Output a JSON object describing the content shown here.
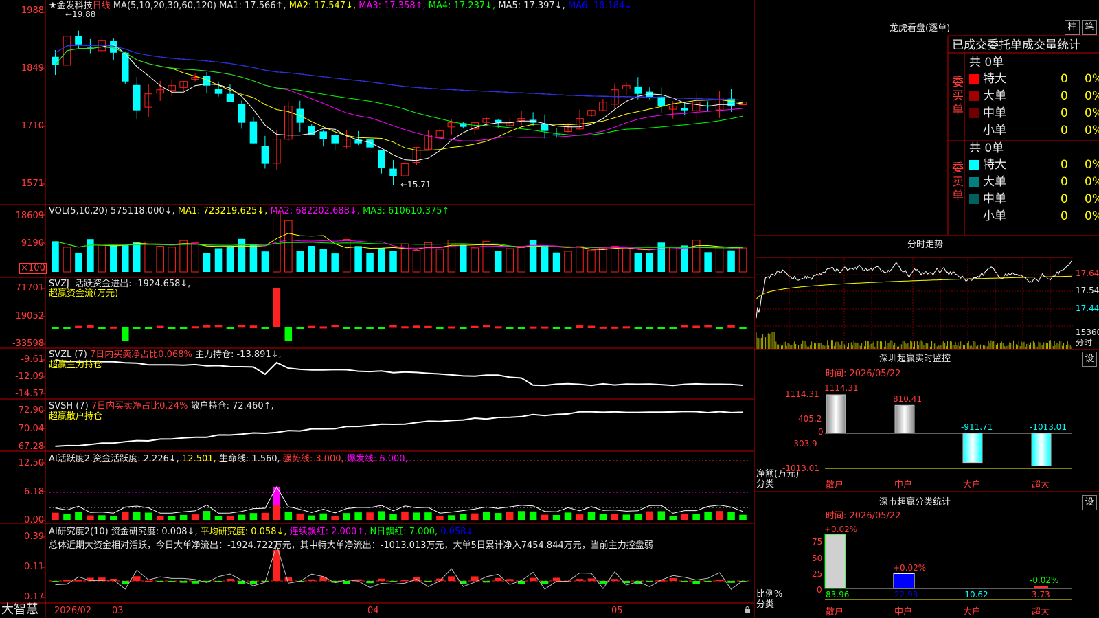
{
  "header": {
    "star": "★",
    "stock_name": "金发科技",
    "period": "日线",
    "ma_label": "MA(5,10,20,30,60,120)",
    "ma1": "MA1: 17.566↑,",
    "ma2": "MA2: 17.547↓,",
    "ma3": "MA3: 17.358↑,",
    "ma4": "MA4: 17.237↓,",
    "ma5": "MA5: 17.397↓,",
    "ma6": "MA6: 18.184↓"
  },
  "price_panel": {
    "yticks": [
      "1988",
      "1849",
      "1710",
      "1571"
    ],
    "high_note": "←19.88",
    "low_note": "←15.71"
  },
  "vol_panel": {
    "label": "VOL(5,10,20)",
    "value": "575118.000↓,",
    "ma1": "MA1: 723219.625↓,",
    "ma2": "MA2: 682202.688↓,",
    "ma3": "MA3: 610610.375↑",
    "yticks": [
      "18609",
      "9190",
      "×100"
    ]
  },
  "svzj_panel": {
    "label": "SVZJ",
    "value": "活跃资金进出: -1924.658↓,",
    "name": "超赢资金流(万元)",
    "yticks": [
      "71701",
      "19052",
      "-33598"
    ]
  },
  "svzl_panel": {
    "label": "SVZL (7)",
    "ratio": "7日内买卖净占比0.068%",
    "value": "主力持仓: -13.891↓,",
    "name": "超赢主力持仓",
    "yticks": [
      "-9.61",
      "-12.09",
      "-14.57"
    ]
  },
  "svsh_panel": {
    "label": "SVSH (7)",
    "ratio": "7日内买卖净占比0.24%",
    "value": "散户持仓: 72.460↑,",
    "name": "超赢散户持仓",
    "yticks": [
      "72.90",
      "70.04",
      "67.28"
    ]
  },
  "ai_active_panel": {
    "label": "AI活跃度2",
    "v1": "资金活跃度: 2.226↓,",
    "v2": "12.501,",
    "v3": "生命线: 1.560,",
    "v4": "强势线: 3.000,",
    "v5": "爆发线: 6.000,",
    "yticks": [
      "12.50",
      "6.18",
      "0.00"
    ]
  },
  "ai_research_panel": {
    "label": "AI研究度2(10)",
    "v1": "资金研究度: 0.008↓,",
    "v2": "平均研究度: 0.058↓,",
    "v3": "连续飘红: 2.000↑,",
    "v4": "N日飘红: 7.000,",
    "v5": "0.058↓",
    "summary": "总体近期大资金相对活跃，今日大单净流出：-1924.722万元，其中特大单净流出：-1013.013万元，大单5日累计净入7454.844万元，当前主力控盘弱",
    "yticks": [
      "0.39",
      "0.11",
      "-0.17"
    ]
  },
  "xaxis": {
    "brand": "大智慧",
    "labels": [
      "2026/02",
      "03",
      "04",
      "05"
    ]
  },
  "dragon_tiger": {
    "title": "龙虎看盘(逐单)",
    "btn1": "柱",
    "btn2": "笔",
    "subtitle": "已成交委托单成交量统计",
    "buy": {
      "side_label": "委买单",
      "total": "共 0单",
      "rows": [
        {
          "label": "特大",
          "count": "0",
          "pct": "0%",
          "color": "#ff0000"
        },
        {
          "label": "大单",
          "count": "0",
          "pct": "0%",
          "color": "#a00000"
        },
        {
          "label": "中单",
          "count": "0",
          "pct": "0%",
          "color": "#700000"
        },
        {
          "label": "小单",
          "count": "0",
          "pct": "0%",
          "color": ""
        }
      ]
    },
    "sell": {
      "side_label": "委卖单",
      "total": "共 0单",
      "rows": [
        {
          "label": "特大",
          "count": "0",
          "pct": "0%",
          "color": "#00ffff"
        },
        {
          "label": "大单",
          "count": "0",
          "pct": "0%",
          "color": "#008080"
        },
        {
          "label": "中单",
          "count": "0",
          "pct": "0%",
          "color": "#006060"
        },
        {
          "label": "小单",
          "count": "0",
          "pct": "0%",
          "color": ""
        }
      ]
    }
  },
  "intraday": {
    "title": "分时走势",
    "yticks": [
      "17.64",
      "17.54",
      "17.44"
    ],
    "vol_label": "15360",
    "vol_unit": "分时"
  },
  "sz_monitor": {
    "title": "深圳超赢实时监控",
    "btn": "设",
    "time": "时间: 2026/05/22",
    "yticks": [
      "1114.31",
      "405.2",
      "0",
      "-303.9",
      "-1013.01"
    ],
    "unit_label": "净额(万元)",
    "cat_label": "分类",
    "categories": [
      "散户",
      "中户",
      "大户",
      "超大"
    ],
    "values": [
      1114.31,
      810.41,
      -911.71,
      -1013.01
    ],
    "value_labels": [
      "1114.31",
      "810.41",
      "-911.71",
      "-1013.01"
    ]
  },
  "sz_classify": {
    "title": "深市超赢分类统计",
    "btn": "设",
    "time": "时间: 2026/05/22",
    "yticks": [
      "75",
      "50",
      "25",
      "0"
    ],
    "unit_label": "比例%",
    "cat_label": "分类",
    "categories": [
      "散户",
      "中户",
      "大户",
      "超大"
    ],
    "values": [
      83.96,
      22.93,
      -10.62,
      3.73
    ],
    "bottom_labels": [
      "83.96",
      "22.93",
      "-10.62",
      "3.73"
    ],
    "delta_labels": [
      "+0.02%",
      "+0.02%",
      "",
      "-0.02%"
    ]
  }
}
